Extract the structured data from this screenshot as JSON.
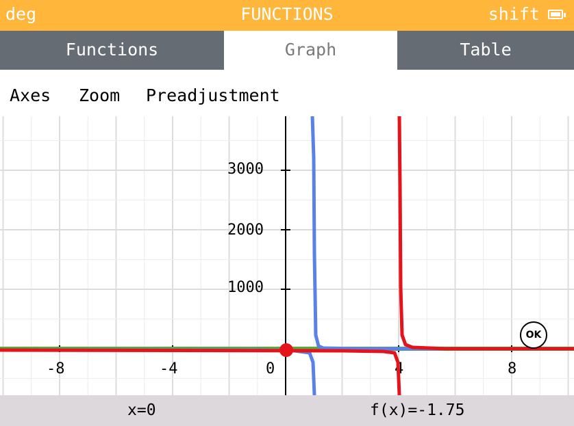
{
  "status": {
    "angle_unit": "deg",
    "title": "FUNCTIONS",
    "modifier": "shift",
    "battery_icon": "battery-icon"
  },
  "tabs": [
    {
      "label": "Functions",
      "active": false
    },
    {
      "label": "Graph",
      "active": true
    },
    {
      "label": "Table",
      "active": false
    }
  ],
  "menu": {
    "axes": "Axes",
    "zoom": "Zoom",
    "preadjustment": "Preadjustment"
  },
  "ok_button": {
    "label": "OK"
  },
  "cursor": {
    "x": 0,
    "y": -1.75
  },
  "banner": {
    "x_readout": "x=0",
    "fx_readout": "f(x)=-1.75"
  },
  "colors": {
    "header": "#ffb63b",
    "tab_bar": "#666c73",
    "banner": "#dcd8db",
    "blue_curve": "#5a82e6",
    "red_curve": "#e5141b",
    "green_curve": "#5aa83c",
    "cursor_dot": "#e5141b",
    "grid": "#ececec"
  },
  "chart_data": {
    "type": "line",
    "x_ticks": [
      "-8",
      "-4",
      "0",
      "4",
      "8"
    ],
    "y_ticks": [
      "1000",
      "2000",
      "3000"
    ],
    "xlim": [
      -10,
      10
    ],
    "ylim": [
      -800,
      4000
    ],
    "grid": true,
    "series": [
      {
        "color": "blue",
        "asymptote_x": 1,
        "description": "vertical asymptote near x=1"
      },
      {
        "color": "red",
        "asymptote_x": 4,
        "description": "vertical asymptote near x=4"
      },
      {
        "color": "green",
        "constant_y": 0
      }
    ]
  }
}
